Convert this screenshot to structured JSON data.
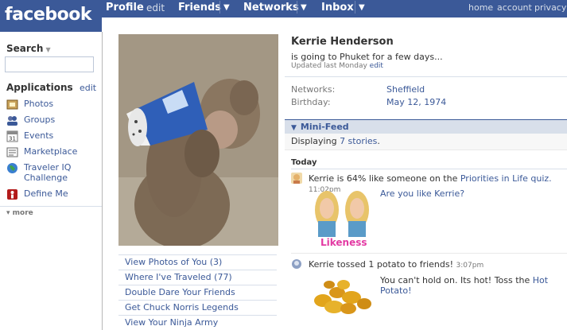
{
  "brand": {
    "logo": "facebook"
  },
  "nav": {
    "profile": "Profile",
    "profile_edit": "edit",
    "friends": "Friends",
    "networks": "Networks",
    "inbox": "Inbox",
    "dropdown": "▼",
    "home": "home",
    "account": "account",
    "privacy": "privacy"
  },
  "sidebar": {
    "search_label": "Search",
    "search_placeholder": "",
    "applications_label": "Applications",
    "applications_edit": "edit",
    "apps": [
      {
        "label": "Photos",
        "icon": "photos-icon"
      },
      {
        "label": "Groups",
        "icon": "groups-icon"
      },
      {
        "label": "Events",
        "icon": "events-icon"
      },
      {
        "label": "Marketplace",
        "icon": "marketplace-icon"
      },
      {
        "label": "Traveler IQ Challenge",
        "icon": "globe-icon"
      },
      {
        "label": "Define Me",
        "icon": "define-me-icon"
      }
    ],
    "more": "more"
  },
  "profile_links": [
    "View Photos of You (3)",
    "Where I've Traveled (77)",
    "Double Dare Your Friends",
    "Get Chuck Norris Legends",
    "View Your Ninja Army"
  ],
  "profile": {
    "name": "Kerrie Henderson",
    "status": "is going to Phuket for a few days...",
    "updated_prefix": "Updated last Monday",
    "updated_edit": "edit",
    "networks_label": "Networks:",
    "networks_value": "Sheffield",
    "birthday_label": "Birthday:",
    "birthday_value": "May 12, 1974"
  },
  "minifeed": {
    "title": "Mini-Feed",
    "displaying_prefix": "Displaying",
    "displaying_link": "7 stories",
    "displaying_suffix": ".",
    "today": "Today",
    "story1": {
      "text": "Kerrie is 64% like someone on the",
      "link": "Priorities in Life quiz.",
      "time": "11:02pm",
      "question": "Are you like Kerrie?",
      "badge": "Likeness"
    },
    "story2": {
      "text": "Kerrie tossed 1 potato to friends!",
      "time": "3:07pm",
      "body": "You can't hold on. Its hot! Toss the",
      "link": "Hot Potato!"
    }
  },
  "colors": {
    "brand": "#3b5998",
    "likeness": "#e33aa3",
    "potato": "#e2a51c"
  }
}
